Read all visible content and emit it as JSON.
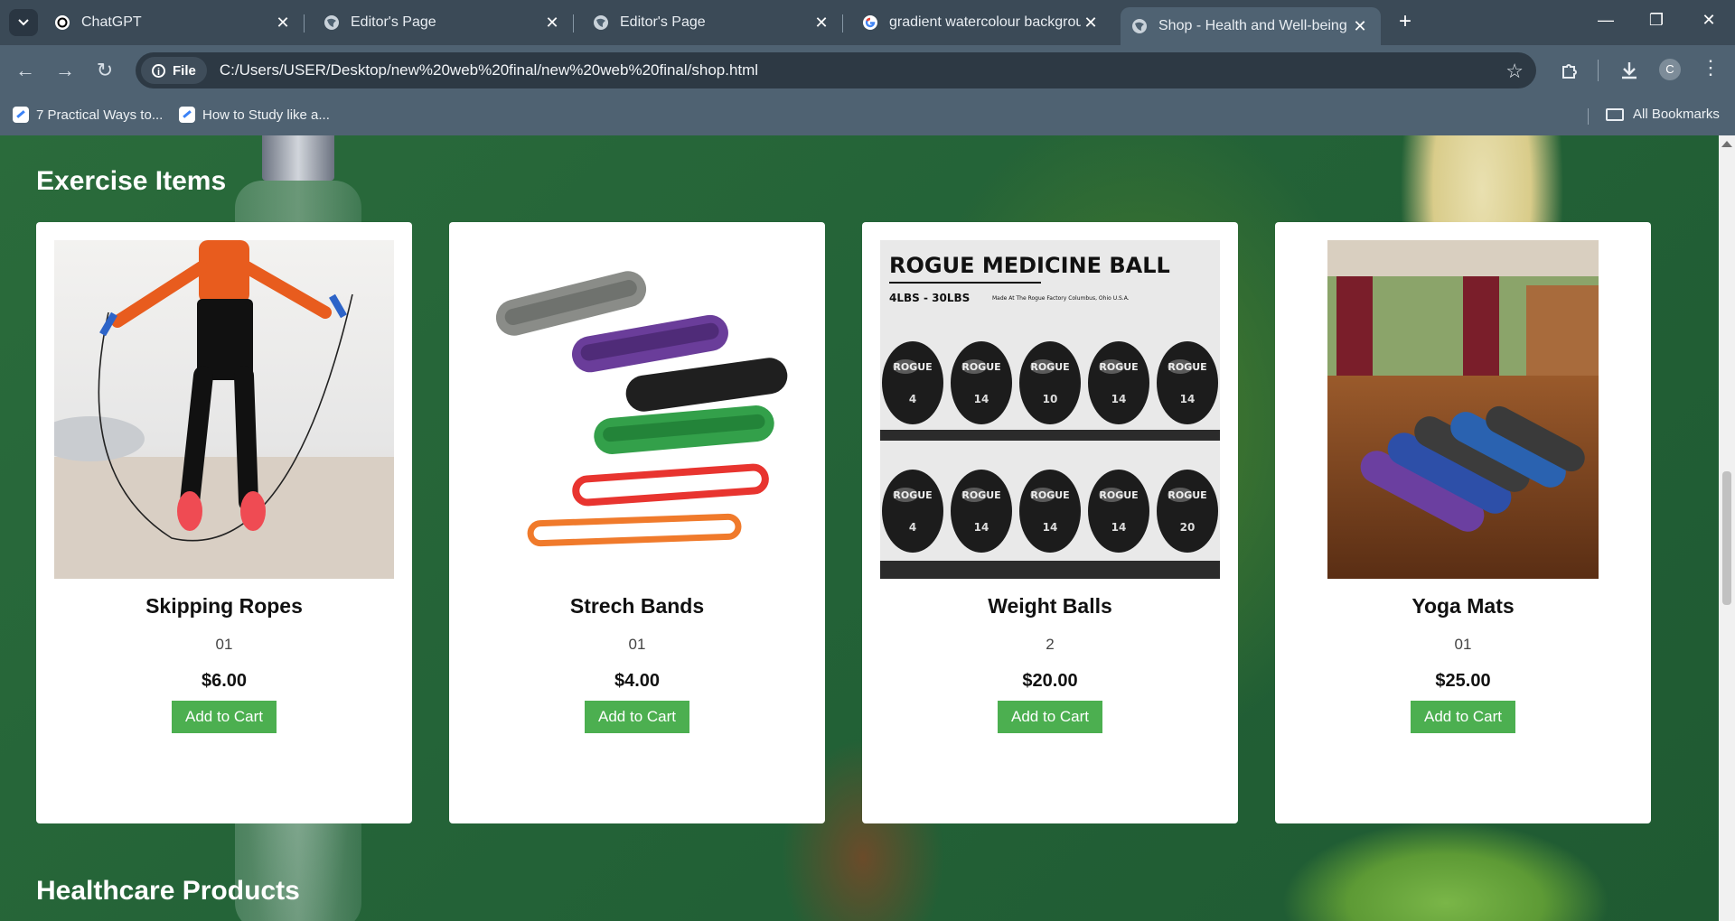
{
  "browser": {
    "tabs": [
      {
        "title": "ChatGPT"
      },
      {
        "title": "Editor's Page"
      },
      {
        "title": "Editor's Page"
      },
      {
        "title": "gradient watercolour backgrou"
      },
      {
        "title": "Shop - Health and Well-being"
      }
    ],
    "url": "C:/Users/USER/Desktop/new%20web%20final/new%20web%20final/shop.html",
    "file_chip": "File",
    "profile_initial": "C",
    "bookmarks": [
      {
        "label": "7 Practical Ways to..."
      },
      {
        "label": "How to Study like a..."
      }
    ],
    "all_bookmarks": "All Bookmarks"
  },
  "sections": {
    "exercise_title": "Exercise Items",
    "healthcare_title": "Healthcare Products"
  },
  "products": [
    {
      "name": "Skipping Ropes",
      "qty": "01",
      "price": "$6.00",
      "button": "Add to Cart"
    },
    {
      "name": "Strech Bands",
      "qty": "01",
      "price": "$4.00",
      "button": "Add to Cart"
    },
    {
      "name": "Weight Balls",
      "qty": "2",
      "price": "$20.00",
      "button": "Add to Cart"
    },
    {
      "name": "Yoga Mats",
      "qty": "01",
      "price": "$25.00",
      "button": "Add to Cart"
    }
  ],
  "medicine_ball_sign": {
    "title": "ROGUE MEDICINE BALL",
    "weights": "4LBS - 30LBS",
    "origin": "Made At The Rogue Factory Columbus, Ohio U.S.A.",
    "brand": "ROGUE",
    "ball_numbers_top": [
      "4",
      "14",
      "10",
      "14",
      "14"
    ],
    "ball_numbers_bottom": [
      "4",
      "14",
      "14",
      "14",
      "20"
    ]
  }
}
